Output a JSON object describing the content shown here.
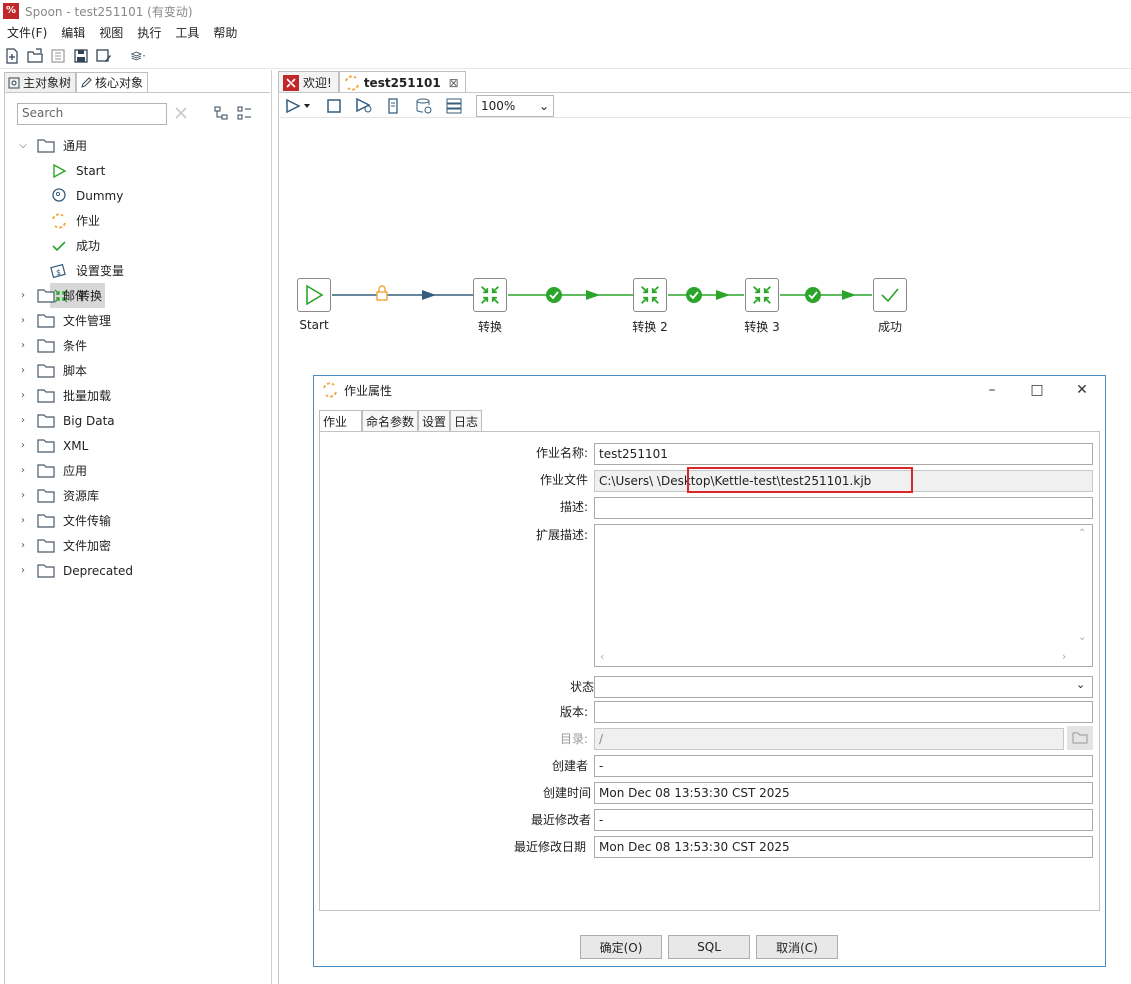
{
  "window": {
    "title": "Spoon - test251101 (有变动)",
    "app_icon_text": "%"
  },
  "menu": [
    "文件(F)",
    "编辑",
    "视图",
    "执行",
    "工具",
    "帮助"
  ],
  "left": {
    "tabs": [
      "主对象树",
      "核心对象"
    ],
    "search_placeholder": "Search",
    "tree": {
      "root": "通用",
      "children": [
        "Start",
        "Dummy",
        "作业",
        "成功",
        "设置变量",
        "转换"
      ],
      "folders": [
        "邮件",
        "文件管理",
        "条件",
        "脚本",
        "批量加载",
        "Big Data",
        "XML",
        "应用",
        "资源库",
        "文件传输",
        "文件加密",
        "Deprecated"
      ]
    }
  },
  "editor_tabs": [
    {
      "label": "欢迎!"
    },
    {
      "label": "test251101",
      "close": "⊠"
    }
  ],
  "canvas_toolbar": {
    "zoom": "100%"
  },
  "job": {
    "steps": [
      "Start",
      "转换",
      "转换 2",
      "转换 3",
      "成功"
    ]
  },
  "dialog": {
    "title": "作业属性",
    "tabs": [
      "作业",
      "命名参数",
      "设置",
      "日志"
    ],
    "fields": [
      {
        "label": "作业名称:",
        "value": "test251101"
      },
      {
        "label": "作业文件",
        "value": "C:\\Users\\       \\Desktop\\Kettle-test\\test251101.kjb"
      },
      {
        "label": "描述:",
        "value": ""
      },
      {
        "label": "扩展描述:",
        "value": ""
      },
      {
        "label": "状态",
        "value": ""
      },
      {
        "label": "版本:",
        "value": ""
      },
      {
        "label": "目录:",
        "value": "/"
      },
      {
        "label": "创建者",
        "value": "-"
      },
      {
        "label": "创建时间",
        "value": "Mon Dec 08 13:53:30 CST 2025"
      },
      {
        "label": "最近修改者",
        "value": "-"
      },
      {
        "label": "最近修改日期",
        "value": "Mon Dec 08 13:53:30 CST 2025"
      }
    ],
    "buttons": {
      "ok": "确定(O)",
      "sql": "SQL",
      "cancel": "取消(C)"
    }
  },
  "colors": {
    "highlight_box": "#d9262b",
    "green": "#2aa52a",
    "hop_blue": "#355e7e",
    "lock_orange": "#f2a33a"
  }
}
